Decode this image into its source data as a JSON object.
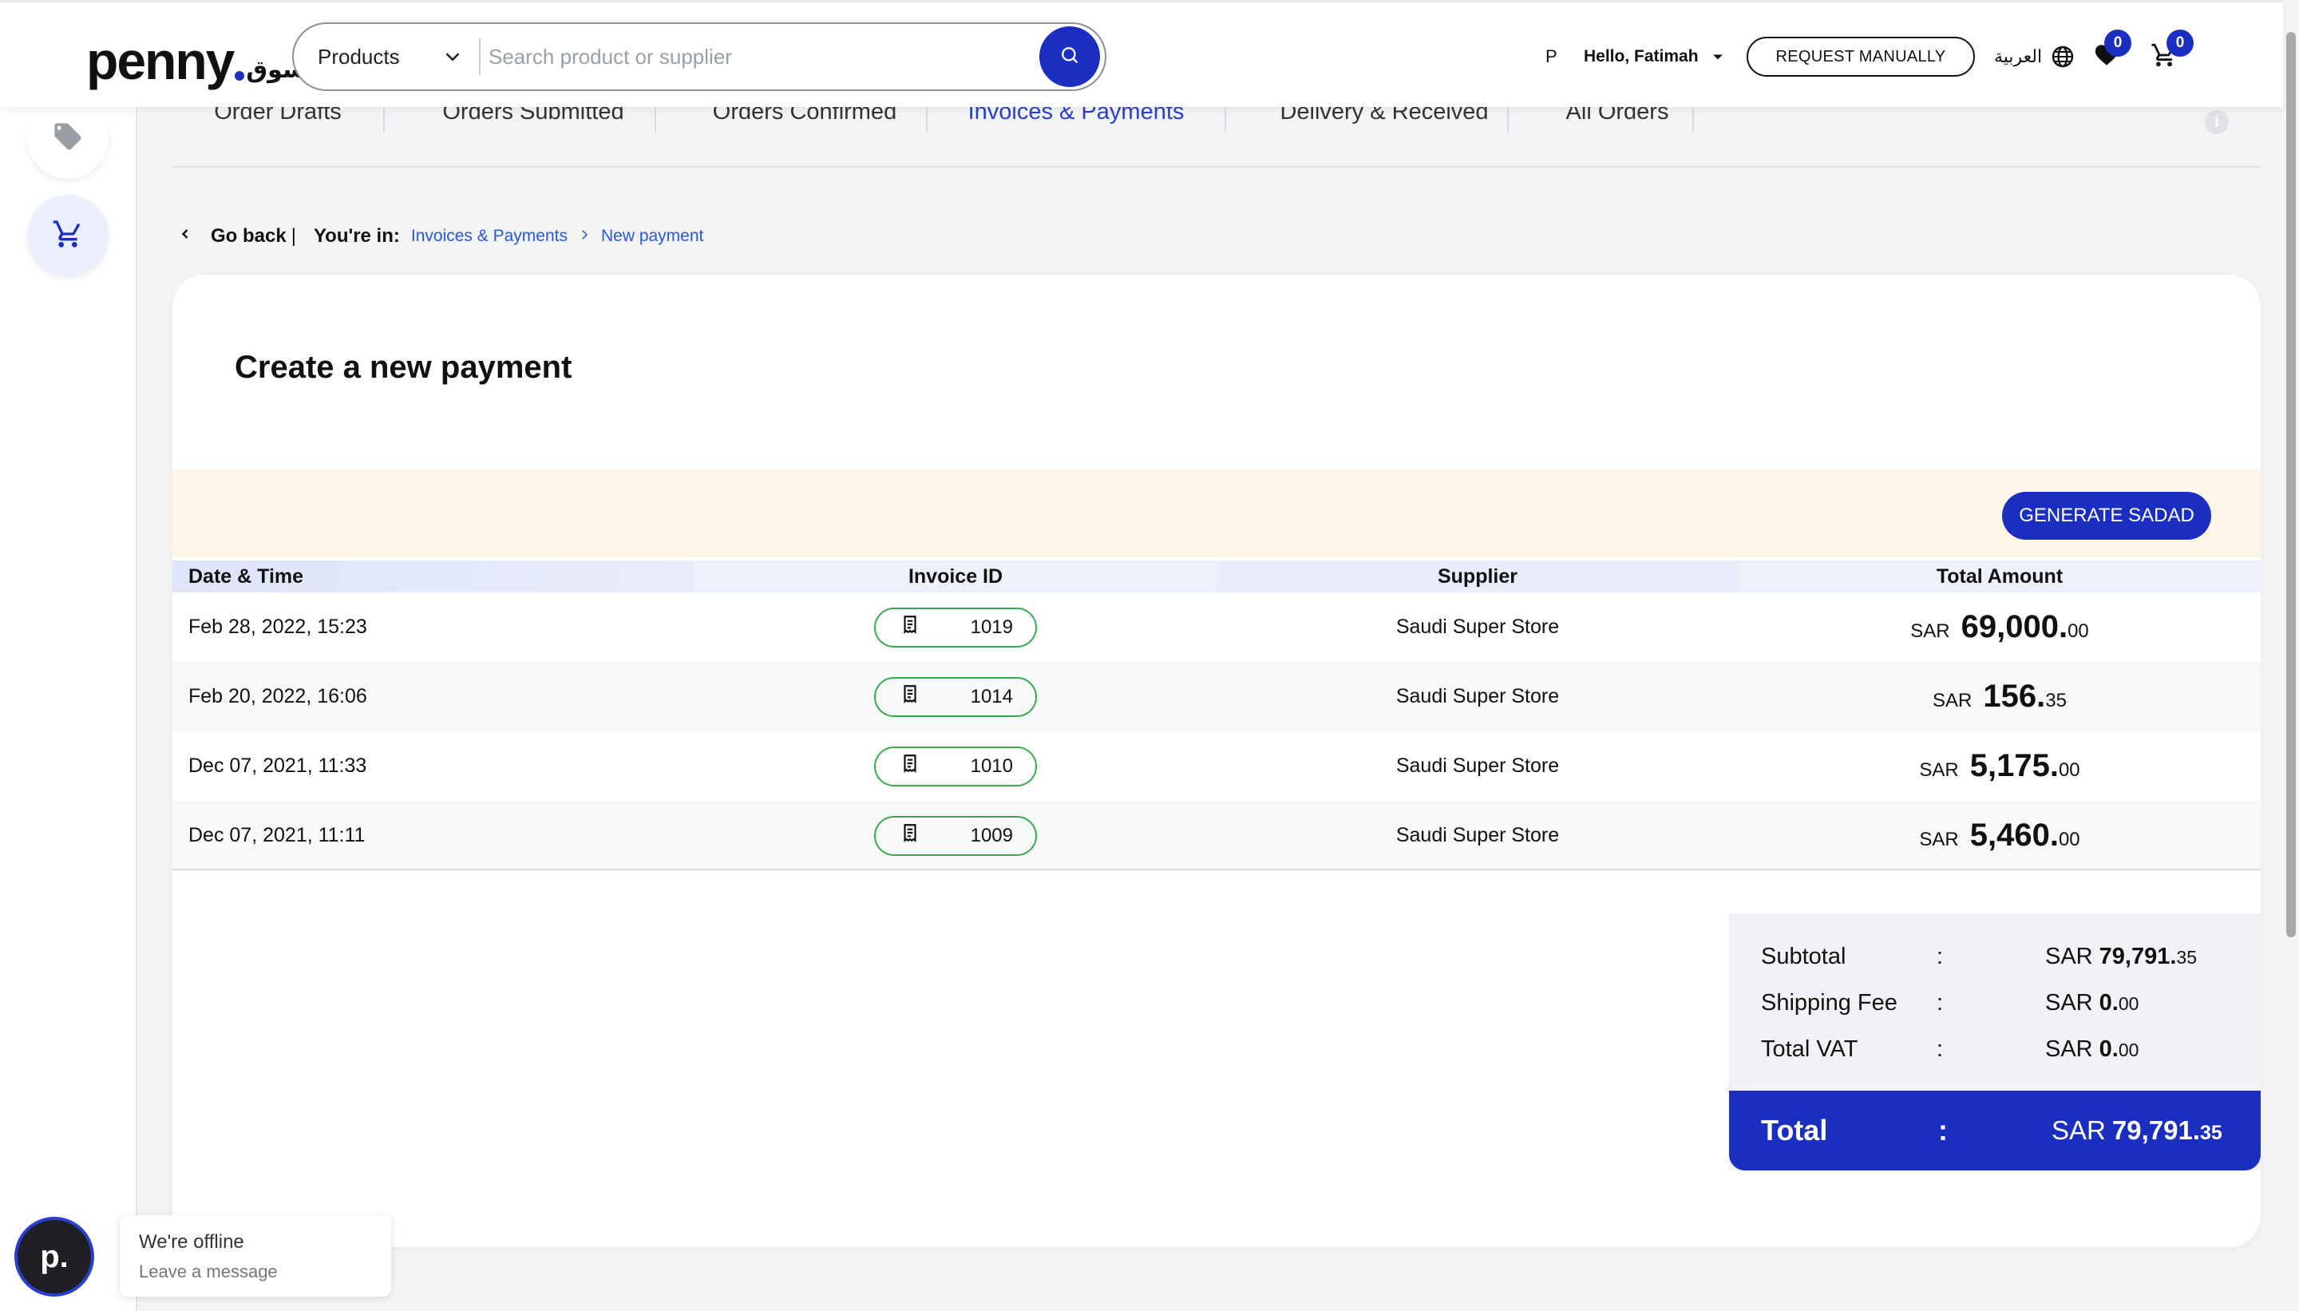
{
  "header": {
    "logo_text": "penny",
    "logo_ar": "سوق",
    "category_select": "Products",
    "search_placeholder": "Search product or supplier",
    "user_initial": "P",
    "greeting": "Hello, Fatimah",
    "request_button": "REQUEST MANUALLY",
    "language": "العربية",
    "wishlist_count": "0",
    "cart_count": "0"
  },
  "tabs": [
    {
      "label": "Order Drafts"
    },
    {
      "label": "Orders Submitted"
    },
    {
      "label": "Orders Confirmed"
    },
    {
      "label": "Invoices & Payments",
      "active": true
    },
    {
      "label": "Delivery & Received"
    },
    {
      "label": "All Orders"
    }
  ],
  "breadcrumb": {
    "back_label": "Go back",
    "pipe": "|",
    "youre_in": "You're in:",
    "items": [
      "Invoices & Payments",
      "New payment"
    ]
  },
  "page_title": "Create a new payment",
  "sadad_button": "GENERATE SADAD",
  "table": {
    "columns": [
      "Date & Time",
      "Invoice ID",
      "Supplier",
      "Total Amount"
    ],
    "rows": [
      {
        "date": "Feb 28, 2022, 15:23",
        "invoice_id": "1019",
        "supplier": "Saudi Super Store",
        "currency": "SAR",
        "amount_main": "69,000.",
        "amount_dec": "00"
      },
      {
        "date": "Feb 20, 2022, 16:06",
        "invoice_id": "1014",
        "supplier": "Saudi Super Store",
        "currency": "SAR",
        "amount_main": "156.",
        "amount_dec": "35"
      },
      {
        "date": "Dec 07, 2021, 11:33",
        "invoice_id": "1010",
        "supplier": "Saudi Super Store",
        "currency": "SAR",
        "amount_main": "5,175.",
        "amount_dec": "00"
      },
      {
        "date": "Dec 07, 2021, 11:11",
        "invoice_id": "1009",
        "supplier": "Saudi Super Store",
        "currency": "SAR",
        "amount_main": "5,460.",
        "amount_dec": "00"
      }
    ]
  },
  "summary": {
    "subtotal": {
      "label": "Subtotal",
      "colon": ":",
      "currency": "SAR",
      "main": "79,791.",
      "dec": "35"
    },
    "shipping": {
      "label": "Shipping Fee",
      "colon": ":",
      "currency": "SAR",
      "main": "0.",
      "dec": "00"
    },
    "vat": {
      "label": "Total VAT",
      "colon": ":",
      "currency": "SAR",
      "main": "0.",
      "dec": "00"
    },
    "total": {
      "label": "Total",
      "colon": ":",
      "currency": "SAR",
      "main": "79,791.",
      "dec": "35"
    }
  },
  "chat": {
    "avatar_letter": "p.",
    "status": "We're offline",
    "cta": "Leave a message"
  },
  "colors": {
    "brand_blue": "#1a2ec2",
    "active_tab": "#2a3fd0",
    "link": "#2a56d9",
    "sadad_band": "#fdf6e6",
    "invoice_chip_border": "#3aa84e"
  }
}
